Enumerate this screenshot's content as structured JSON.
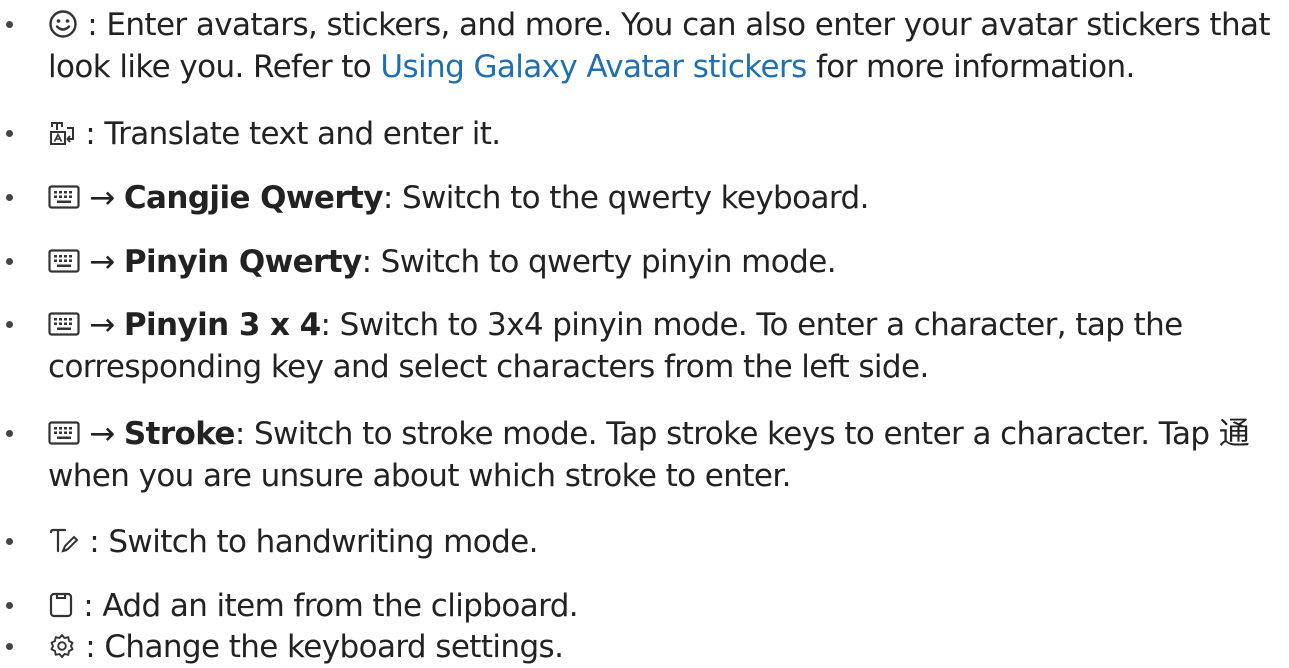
{
  "items": [
    {
      "icon": "smiley-icon",
      "sep": " : ",
      "lines": [
        "Enter avatars, stickers, and more. You can also enter your avatar stickers that"
      ],
      "line2_pre": "look like you. Refer to ",
      "link": "Using Galaxy Avatar stickers",
      "line2_post": " for more information."
    },
    {
      "icon": "translate-icon",
      "sep": " : ",
      "text": "Translate text and enter it."
    },
    {
      "icon": "keyboard-icon",
      "arrow": "→",
      "bold": "Cangjie Qwerty",
      "text": ": Switch to the qwerty keyboard."
    },
    {
      "icon": "keyboard-icon",
      "arrow": "→",
      "bold": "Pinyin Qwerty",
      "text": ": Switch to qwerty pinyin mode."
    },
    {
      "icon": "keyboard-icon",
      "arrow": "→",
      "bold": "Pinyin 3 x 4",
      "text": ": Switch to 3x4 pinyin mode. To enter a character, tap the",
      "text2": "corresponding key and select characters from the left side."
    },
    {
      "icon": "keyboard-icon",
      "arrow": "→",
      "bold": "Stroke",
      "text": ": Switch to stroke mode. Tap stroke keys to enter a character. Tap 通",
      "text2": "when you are unsure about which stroke to enter."
    },
    {
      "icon": "handwriting-icon",
      "sep": " : ",
      "text": "Switch to handwriting mode."
    },
    {
      "icon": "clipboard-icon",
      "sep": " : ",
      "text": "Add an item from the clipboard."
    },
    {
      "icon": "gear-icon",
      "sep": " : ",
      "text": "Change the keyboard settings."
    }
  ]
}
